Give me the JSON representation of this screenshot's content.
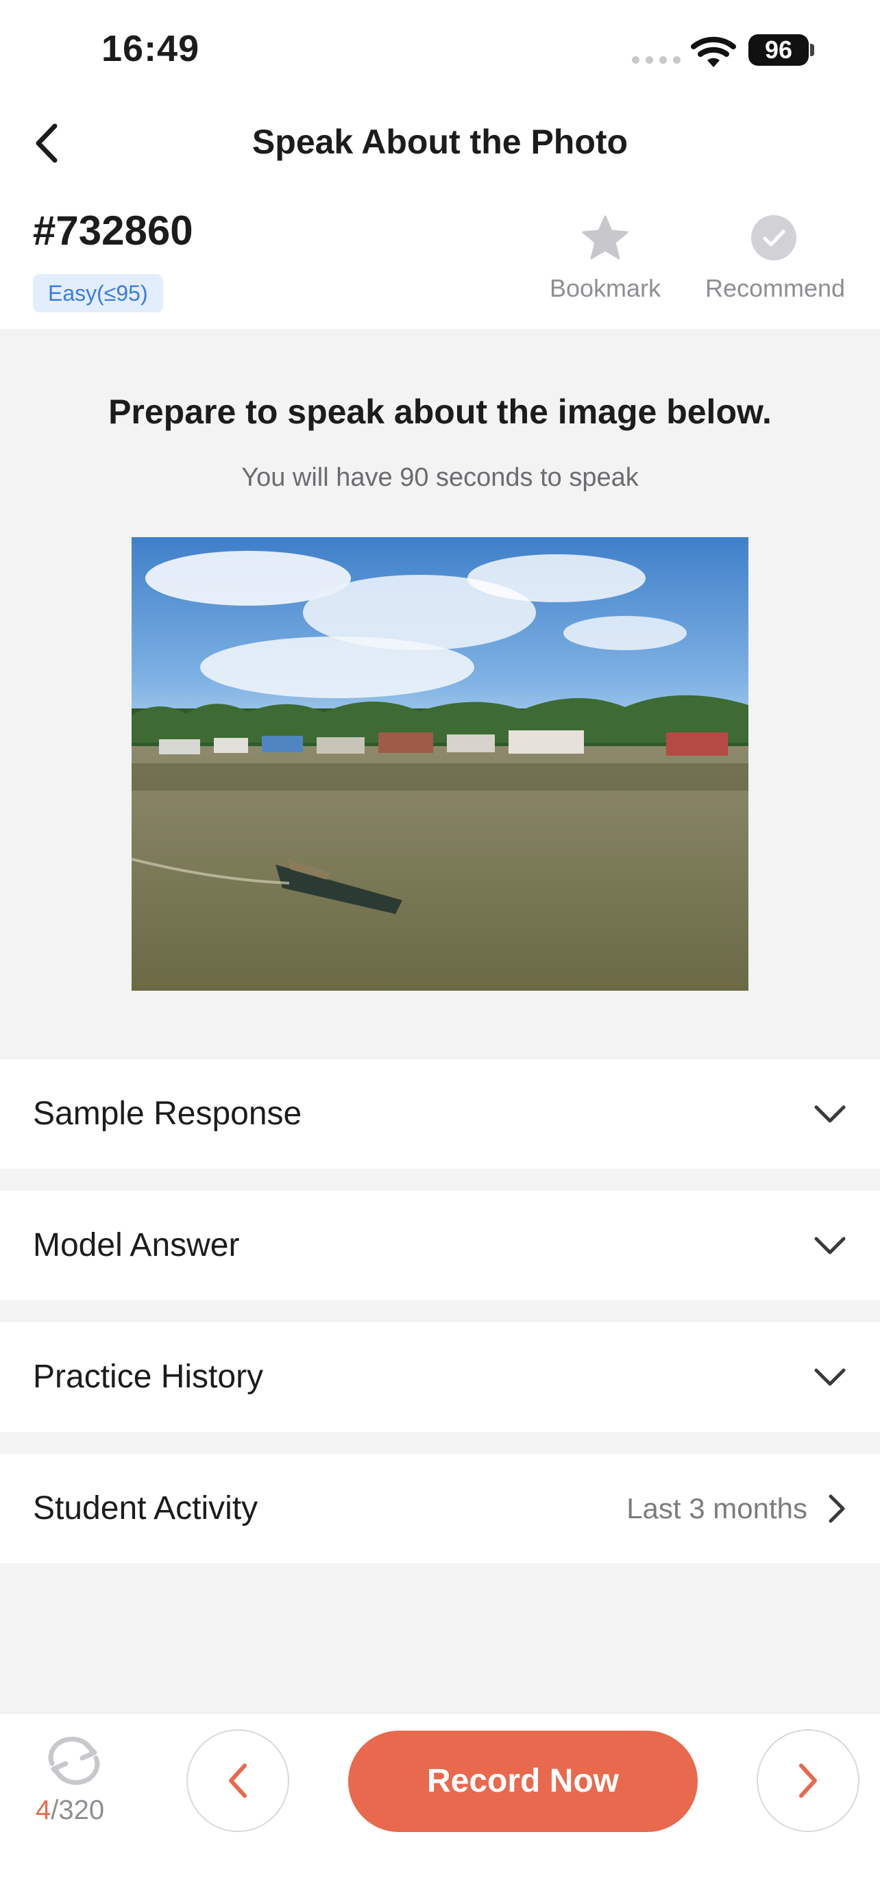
{
  "status": {
    "time": "16:49",
    "battery": "96"
  },
  "nav": {
    "title": "Speak About the Photo"
  },
  "question": {
    "id": "#732860",
    "difficulty": "Easy(≤95)",
    "bookmark_label": "Bookmark",
    "recommend_label": "Recommend"
  },
  "prompt": {
    "title": "Prepare to speak about the image below.",
    "subtitle": "You will have 90 seconds to speak"
  },
  "sections": {
    "sample": "Sample Response",
    "model": "Model Answer",
    "history": "Practice History",
    "activity": "Student Activity",
    "activity_range": "Last 3 months"
  },
  "footer": {
    "current": "4",
    "total": "/320",
    "record_label": "Record Now"
  },
  "colors": {
    "accent": "#e8694d",
    "badge_bg": "#e3eefc",
    "badge_text": "#3a7ce0"
  }
}
